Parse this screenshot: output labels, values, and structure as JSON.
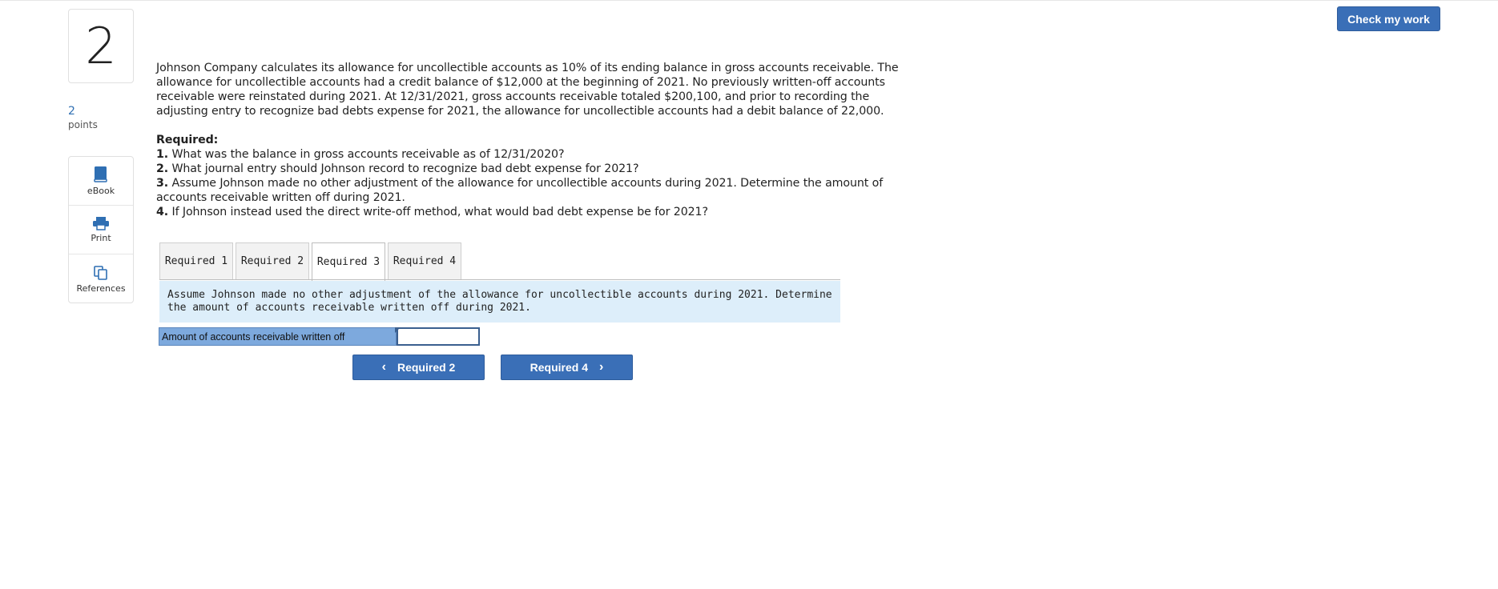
{
  "header": {
    "check_label": "Check my work"
  },
  "question": {
    "number": "2",
    "points_value": "2",
    "points_label": "points"
  },
  "tools": [
    {
      "label": "eBook",
      "icon": "book-icon"
    },
    {
      "label": "Print",
      "icon": "printer-icon"
    },
    {
      "label": "References",
      "icon": "references-icon"
    }
  ],
  "prompt": {
    "paragraph": "Johnson Company calculates its allowance for uncollectible accounts as 10% of its ending balance in gross accounts receivable. The allowance for uncollectible accounts had a credit balance of $12,000 at the beginning of 2021.  No previously written-off accounts receivable were reinstated during 2021.  At 12/31/2021, gross accounts receivable totaled $200,100, and prior to recording the adjusting entry to recognize bad debts expense for 2021, the allowance for uncollectible accounts had a debit balance of 22,000.",
    "required_heading": "Required:",
    "items": [
      {
        "num": "1.",
        "text": "What was the balance in gross accounts receivable as of 12/31/2020?"
      },
      {
        "num": "2.",
        "text": "What journal entry should Johnson record to recognize bad debt expense for 2021?"
      },
      {
        "num": "3.",
        "text": "Assume Johnson made no other adjustment of the allowance for uncollectible accounts during 2021. Determine the amount of accounts receivable written off during 2021."
      },
      {
        "num": "4.",
        "text": "If Johnson instead used the direct write-off method, what would bad debt expense be for 2021?"
      }
    ]
  },
  "tabs": [
    {
      "label": "Required 1",
      "active": false
    },
    {
      "label": "Required 2",
      "active": false
    },
    {
      "label": "Required 3",
      "active": true
    },
    {
      "label": "Required 4",
      "active": false
    }
  ],
  "instruction": "Assume Johnson made no other adjustment of the allowance for uncollectible accounts during 2021. Determine the amount of accounts receivable written off during 2021.",
  "answer": {
    "label": "Amount of accounts receivable written off",
    "value": ""
  },
  "nav": {
    "prev_label": "Required 2",
    "next_label": "Required 4"
  },
  "colors": {
    "primary_button": "#3a6fb7",
    "instruction_bg": "#ddeefa",
    "answer_label_bg": "#7da9dd",
    "points_text": "#2f6fb3"
  }
}
